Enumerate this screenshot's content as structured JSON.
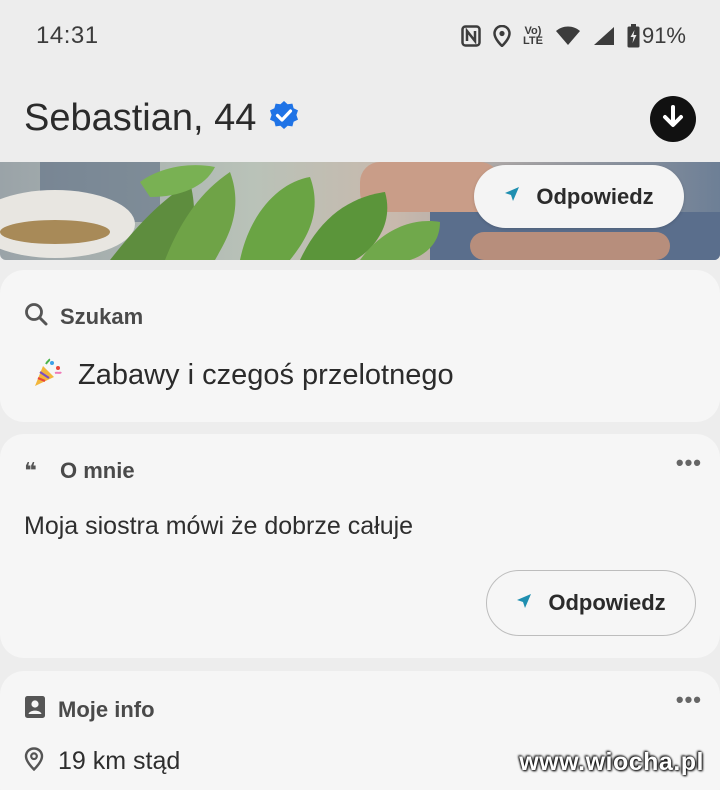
{
  "status_bar": {
    "time": "14:31",
    "battery": "91%",
    "network_badge": "Vo LTE",
    "icons": [
      "nfc-icon",
      "location-icon",
      "volte-icon",
      "wifi-icon",
      "signal-icon",
      "battery-icon"
    ]
  },
  "profile": {
    "name": "Sebastian, 44",
    "verified": true,
    "accent_color": "#1f73e6"
  },
  "photo_reply": {
    "label": "Odpowiedz"
  },
  "seek_card": {
    "heading": "Szukam",
    "emoji": "🎉",
    "value": "Zabawy i czegoś przelotnego"
  },
  "about_card": {
    "heading": "O mnie",
    "quote_glyph": "❝",
    "text": "Moja siostra mówi że dobrze całuje",
    "reply_label": "Odpowiedz",
    "menu": "•••"
  },
  "info_card": {
    "heading": "Moje info",
    "distance": "19 km stąd",
    "menu": "•••"
  },
  "watermark": "www.wiocha.pl",
  "colors": {
    "background": "#ededed",
    "card": "#f6f6f6",
    "reply_arrow": "#1f8fb0"
  }
}
